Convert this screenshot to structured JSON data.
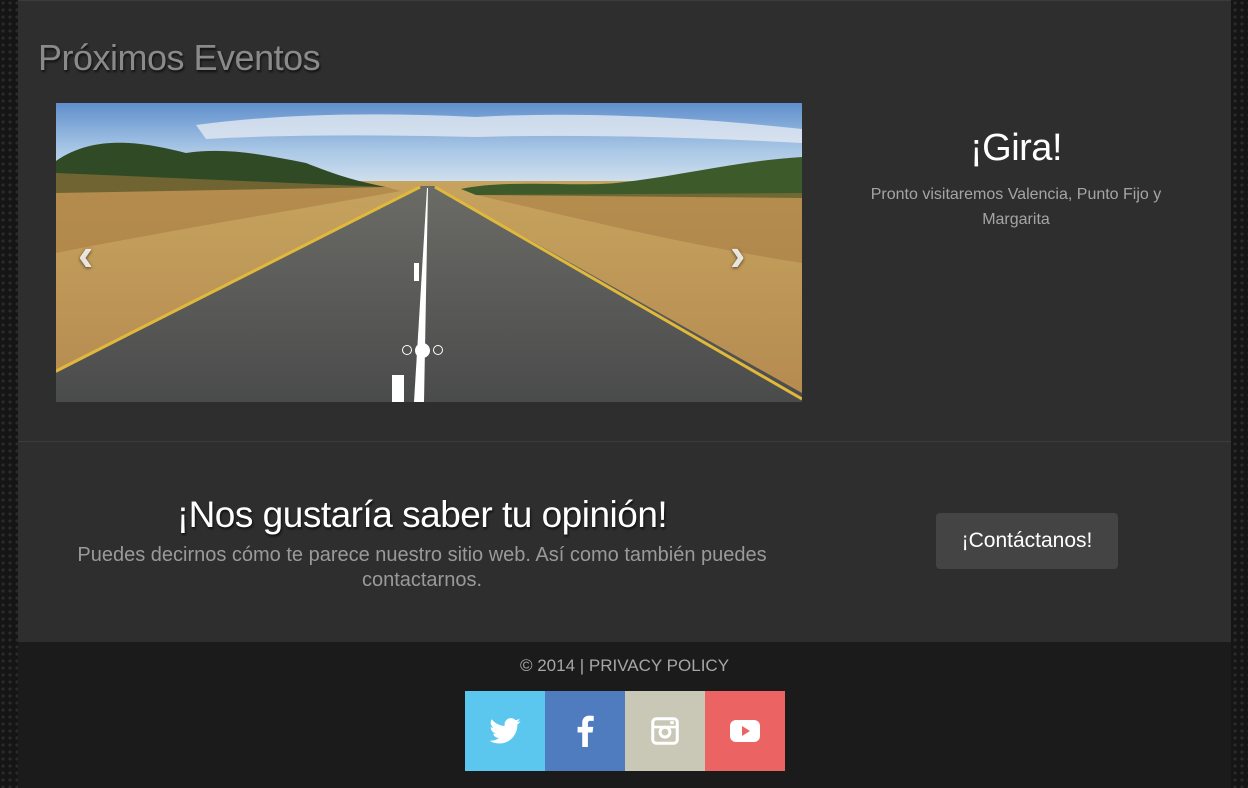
{
  "events": {
    "title": "Próximos Eventos",
    "carousel": {
      "prev_icon": "‹",
      "next_icon": "›",
      "slide_count": 3,
      "active_slide": 2
    },
    "caption": {
      "title": "¡Gira!",
      "text": "Pronto visitaremos Valencia, Punto Fijo y Margarita"
    }
  },
  "feedback": {
    "title": "¡Nos gustaría saber tu opinión!",
    "text": "Puedes decirnos cómo te parece nuestro sitio web. Así como también puedes contactarnos.",
    "button_label": "¡Contáctanos!"
  },
  "footer": {
    "copyright": "© 2014 | ",
    "privacy_label": "PRIVACY POLICY",
    "social": [
      {
        "name": "twitter-icon",
        "color": "#5bc7ee"
      },
      {
        "name": "facebook-icon",
        "color": "#4f7bbf"
      },
      {
        "name": "instagram-icon",
        "color": "#c9c8b6"
      },
      {
        "name": "youtube-icon",
        "color": "#ec6363"
      }
    ]
  }
}
